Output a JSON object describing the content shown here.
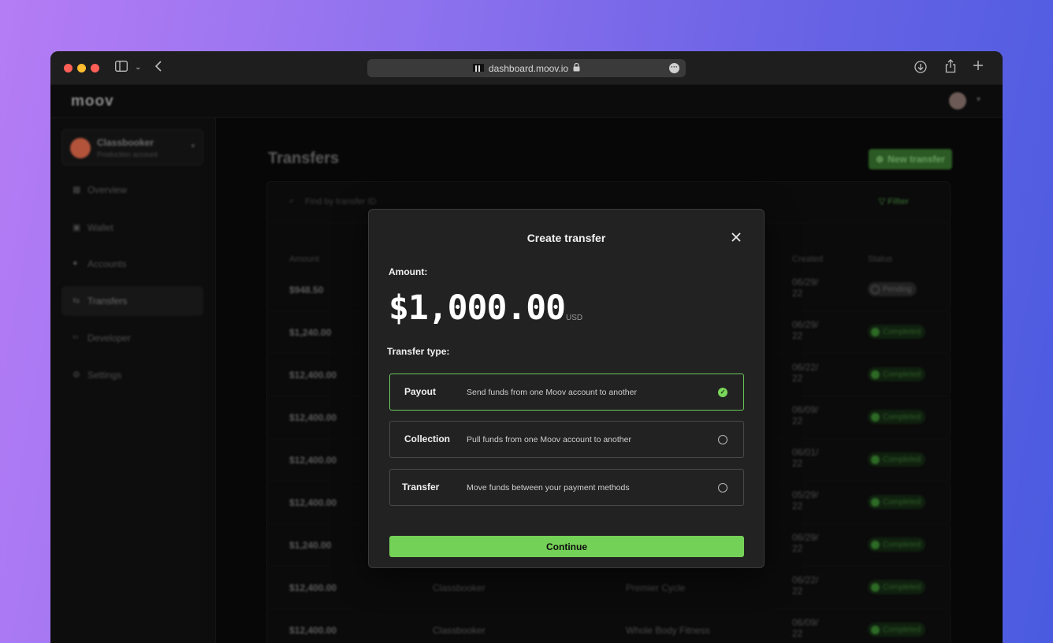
{
  "browser": {
    "url": "dashboard.moov.io",
    "icons": [
      "sidebar-toggle-icon",
      "chevron-down-icon",
      "back-icon",
      "lock-icon",
      "more-icon",
      "download-icon",
      "share-icon",
      "new-tab-icon"
    ]
  },
  "app": {
    "logo": "moov",
    "account": {
      "name": "Classbooker",
      "subtitle": "Production account"
    },
    "nav": [
      {
        "label": "Overview",
        "icon": "grid-icon"
      },
      {
        "label": "Wallet",
        "icon": "wallet-icon"
      },
      {
        "label": "Accounts",
        "icon": "user-icon"
      },
      {
        "label": "Transfers",
        "icon": "transfer-icon",
        "active": true
      },
      {
        "label": "Developer",
        "icon": "code-icon"
      },
      {
        "label": "Settings",
        "icon": "gear-icon"
      }
    ],
    "page_title": "Transfers",
    "new_transfer_label": "New transfer",
    "search_placeholder": "Find by transfer ID",
    "filter_label": "Filter",
    "columns": {
      "amount": "Amount",
      "created": "Created",
      "status": "Status"
    },
    "rows": [
      {
        "amount": "$948.50",
        "from": "",
        "to": "",
        "created": "06/29/22",
        "status": "Pending"
      },
      {
        "amount": "$1,240.00",
        "from": "",
        "to": "",
        "created": "06/29/22",
        "status": "Completed"
      },
      {
        "amount": "$12,400.00",
        "from": "",
        "to": "",
        "created": "06/22/22",
        "status": "Completed"
      },
      {
        "amount": "$12,400.00",
        "from": "",
        "to": "",
        "created": "06/09/22",
        "status": "Completed"
      },
      {
        "amount": "$12,400.00",
        "from": "",
        "to": "",
        "created": "06/01/22",
        "status": "Completed"
      },
      {
        "amount": "$12,400.00",
        "from": "",
        "to": "",
        "created": "05/29/22",
        "status": "Completed"
      },
      {
        "amount": "$1,240.00",
        "from": "",
        "to": "",
        "created": "06/29/22",
        "status": "Completed"
      },
      {
        "amount": "$12,400.00",
        "from": "Classbooker",
        "to": "Premier Cycle",
        "created": "06/22/22",
        "status": "Completed"
      },
      {
        "amount": "$12,400.00",
        "from": "Classbooker",
        "to": "Whole Body Fitness",
        "created": "06/09/22",
        "status": "Completed"
      }
    ]
  },
  "modal": {
    "title": "Create transfer",
    "amount_label": "Amount:",
    "amount_value": "$1,000.00",
    "currency": "USD",
    "type_label": "Transfer type:",
    "options": [
      {
        "name": "Payout",
        "description": "Send funds from one Moov account to another",
        "selected": true
      },
      {
        "name": "Collection",
        "description": "Pull funds from one Moov account to another",
        "selected": false
      },
      {
        "name": "Transfer",
        "description": "Move funds between your payment methods",
        "selected": false
      }
    ],
    "continue_label": "Continue"
  },
  "colors": {
    "accent_green": "#74d157",
    "selected_border": "#6ac85a",
    "modal_bg": "#222222",
    "background_gradient_start": "#b57cf5",
    "background_gradient_end": "#4a5be0"
  }
}
